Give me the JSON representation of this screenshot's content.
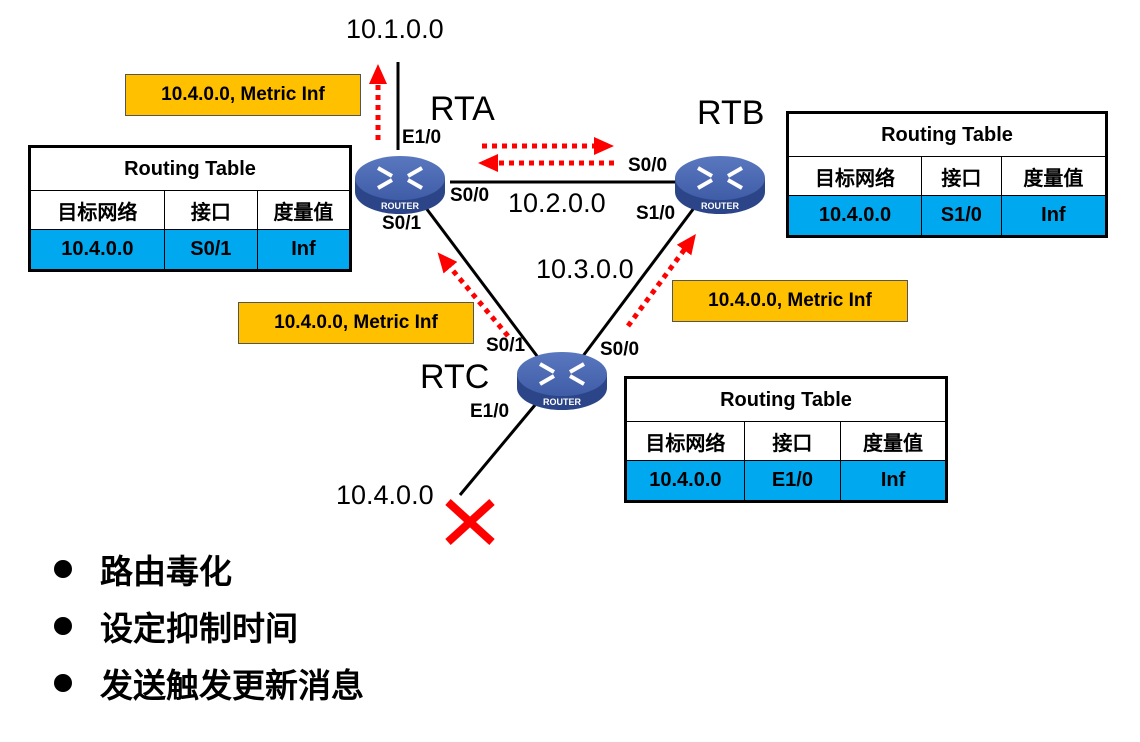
{
  "networks": {
    "net_10_1": "10.1.0.0",
    "net_10_2": "10.2.0.0",
    "net_10_3": "10.3.0.0",
    "net_10_4": "10.4.0.0"
  },
  "routers": {
    "rta": {
      "name": "RTA",
      "badge": "ROUTER",
      "ifaces": {
        "e1_0": "E1/0",
        "s0_0": "S0/0",
        "s0_1": "S0/1"
      }
    },
    "rtb": {
      "name": "RTB",
      "badge": "ROUTER",
      "ifaces": {
        "s0_0": "S0/0",
        "s1_0": "S1/0"
      }
    },
    "rtc": {
      "name": "RTC",
      "badge": "ROUTER",
      "ifaces": {
        "s0_1": "S0/1",
        "s0_0": "S0/0",
        "e1_0": "E1/0"
      }
    }
  },
  "messages": {
    "rta_up": "10.4.0.0, Metric Inf",
    "rtc_left": "10.4.0.0, Metric Inf",
    "rtc_right": "10.4.0.0, Metric Inf"
  },
  "tables": {
    "rta": {
      "title": "Routing Table",
      "headers": [
        "目标网络",
        "接口",
        "度量值"
      ],
      "rows": [
        [
          "10.4.0.0",
          "S0/1",
          "Inf"
        ]
      ]
    },
    "rtb": {
      "title": "Routing Table",
      "headers": [
        "目标网络",
        "接口",
        "度量值"
      ],
      "rows": [
        [
          "10.4.0.0",
          "S1/0",
          "Inf"
        ]
      ]
    },
    "rtc": {
      "title": "Routing Table",
      "headers": [
        "目标网络",
        "接口",
        "度量值"
      ],
      "rows": [
        [
          "10.4.0.0",
          "E1/0",
          "Inf"
        ]
      ]
    }
  },
  "bullets": [
    "路由毒化",
    "设定抑制时间",
    "发送触发更新消息"
  ],
  "colors": {
    "message_bg": "#ffc000",
    "table_row_bg": "#00a8f0",
    "arrow": "#ff0000",
    "router": "#3f5fa8",
    "failure_mark": "#ff0000"
  }
}
